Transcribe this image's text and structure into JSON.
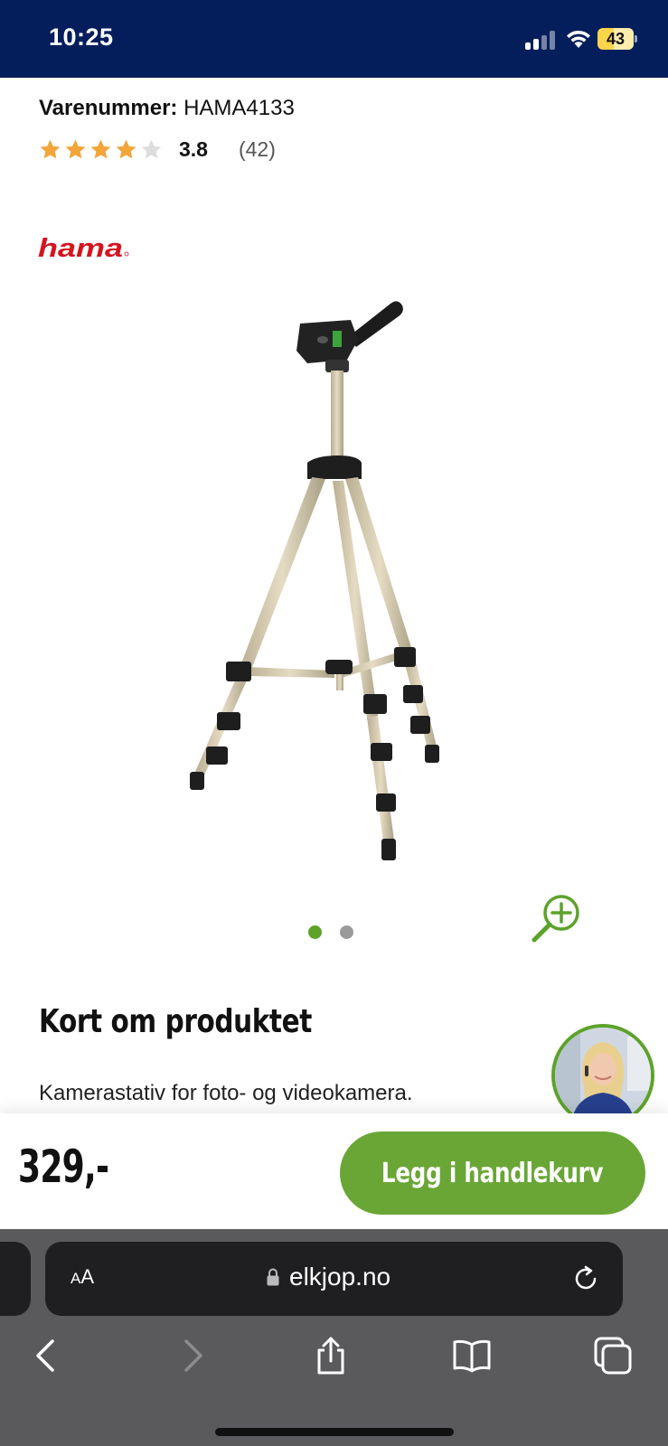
{
  "status_bar": {
    "time": "10:25",
    "battery": "43",
    "background_color": "#041e5c"
  },
  "product": {
    "sku_label": "Varenummer:",
    "sku_value": "HAMA4133",
    "rating": {
      "stars_filled": 4,
      "stars_total": 5,
      "value": "3.8",
      "count": "(42)"
    },
    "brand": "hama",
    "image_dots": {
      "total": 2,
      "active_index": 0
    }
  },
  "section": {
    "title": "Kort om produktet",
    "description": "Kamerastativ for foto- og videokamera."
  },
  "buy_bar": {
    "price": "329,-",
    "add_to_cart_label": "Legg i handlekurv",
    "accent_color": "#6aa636"
  },
  "browser": {
    "aa_label_small": "A",
    "aa_label_large": "A",
    "url": "elkjop.no"
  },
  "icons": {
    "zoom": "zoom-in-icon",
    "lock": "lock-icon",
    "reload": "reload-icon",
    "back": "chevron-left-icon",
    "forward": "chevron-right-icon",
    "share": "share-icon",
    "bookmarks": "book-icon",
    "tabs": "tabs-icon"
  }
}
